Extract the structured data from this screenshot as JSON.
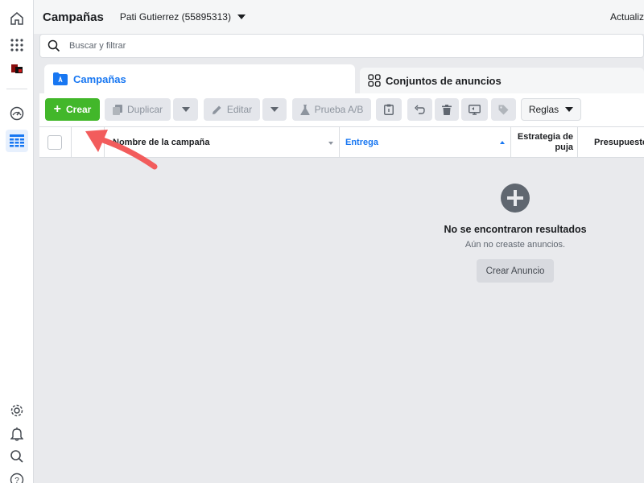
{
  "header": {
    "title": "Campañas",
    "account": "Pati Gutierrez (55895313)",
    "update_link": "Actualiz"
  },
  "search": {
    "placeholder": "Buscar y filtrar"
  },
  "tabs": [
    {
      "label": "Campañas",
      "active": true
    },
    {
      "label": "Conjuntos de anuncios",
      "active": false
    }
  ],
  "toolbar": {
    "create": "Crear",
    "duplicate": "Duplicar",
    "edit": "Editar",
    "ab_test": "Prueba A/B",
    "rules": "Reglas"
  },
  "table": {
    "columns": [
      {
        "label": "Nombre de la campaña"
      },
      {
        "label": "Entrega"
      },
      {
        "label": "Estrategia de puja"
      },
      {
        "label": "Presupuesto"
      }
    ]
  },
  "empty_state": {
    "title": "No se encontraron resultados",
    "subtitle": "Aún no creaste anuncios.",
    "button": "Crear Anuncio"
  },
  "colors": {
    "accent": "#1877f2",
    "create_green": "#42b72a",
    "annotation_arrow": "#f25c5c"
  }
}
